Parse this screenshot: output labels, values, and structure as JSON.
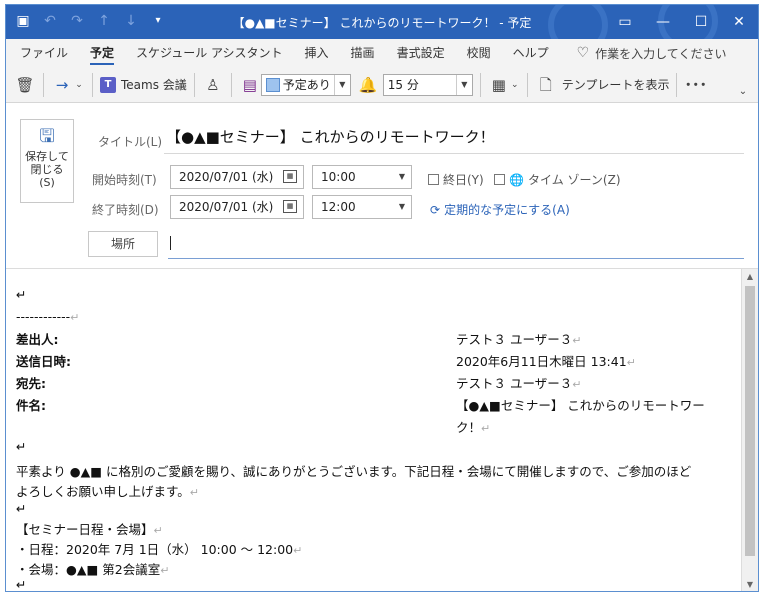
{
  "window": {
    "title": "【●▲■セミナー】 これからのリモートワーク！ - 予定"
  },
  "ribbon": {
    "tabs": [
      "ファイル",
      "予定",
      "スケジュール アシスタント",
      "挿入",
      "描画",
      "書式設定",
      "校閲",
      "ヘルプ"
    ],
    "active_tab": "予定",
    "tell_me_placeholder": "作業を入力してください"
  },
  "toolbar": {
    "teams_label": "Teams 会議",
    "show_as_value": "予定あり",
    "reminder_value": "15 分",
    "template_label": "テンプレートを表示",
    "more_label": "･･･"
  },
  "form": {
    "save_label_line1": "保存して",
    "save_label_line2": "閉じる",
    "save_label_line3": "(S)",
    "title_label": "タイトル(L)",
    "subject": "【●▲■セミナー】 これからのリモートワーク！",
    "start_label": "開始時刻(T)",
    "start_date": "2020/07/01 (水)",
    "start_time": "10:00",
    "end_label": "終了時刻(D)",
    "end_date": "2020/07/01 (水)",
    "end_time": "12:00",
    "allday_label": "終日(Y)",
    "timezone_label": "タイム ゾーン(Z)",
    "recurrence_label": "定期的な予定にする(A)",
    "location_label": "場所"
  },
  "body": {
    "separator": "------------",
    "headers": [
      {
        "key": "差出人:",
        "value": "テスト３  ユーザー３"
      },
      {
        "key": "送信日時:",
        "value": "2020年6月11日木曜日  13:41"
      },
      {
        "key": "宛先:",
        "value": "テスト３  ユーザー３"
      },
      {
        "key": "件名:",
        "value": "【●▲■セミナー】  これからのリモートワー"
      }
    ],
    "subject_cont": "ク！",
    "para1_line1": "平素より  ●▲■  に格別のご愛顧を賜り、誠にありがとうございます。下記日程・会場にて開催しますので、ご参加のほど",
    "para1_line2": "よろしくお願い申し上げます。",
    "section_title": "【セミナー日程・会場】",
    "date_line": "・日程：2020年  7月  1日（水）  10:00  〜  12:00",
    "venue_line": "・会場：●▲■  第2会議室"
  }
}
